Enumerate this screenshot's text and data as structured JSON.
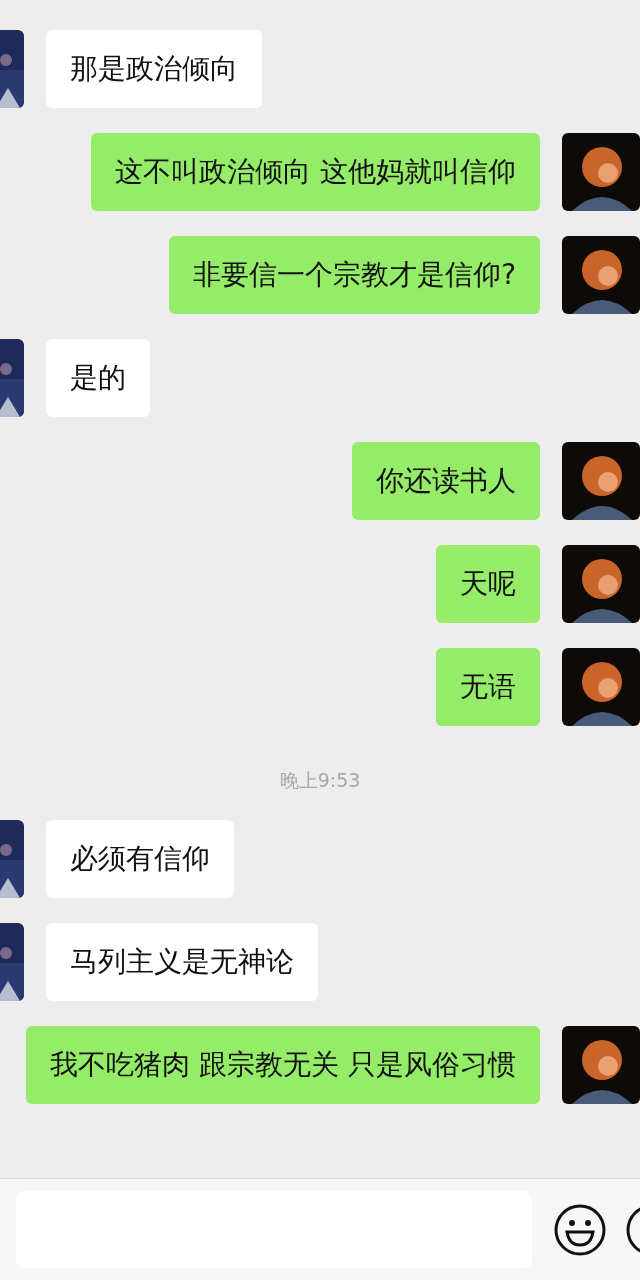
{
  "messages": [
    {
      "kind": "incoming",
      "text": "那是政治倾向"
    },
    {
      "kind": "outgoing",
      "text": "这不叫政治倾向 这他妈就叫信仰"
    },
    {
      "kind": "outgoing",
      "text": "非要信一个宗教才是信仰?"
    },
    {
      "kind": "incoming",
      "text": "是的"
    },
    {
      "kind": "outgoing",
      "text": "你还读书人"
    },
    {
      "kind": "outgoing",
      "text": "天呢"
    },
    {
      "kind": "outgoing",
      "text": "无语"
    },
    {
      "kind": "time",
      "text": "晚上9:53"
    },
    {
      "kind": "incoming",
      "text": "必须有信仰"
    },
    {
      "kind": "incoming",
      "text": "马列主义是无神论"
    },
    {
      "kind": "outgoing",
      "text": "我不吃猪肉 跟宗教无关 只是风俗习惯"
    }
  ]
}
